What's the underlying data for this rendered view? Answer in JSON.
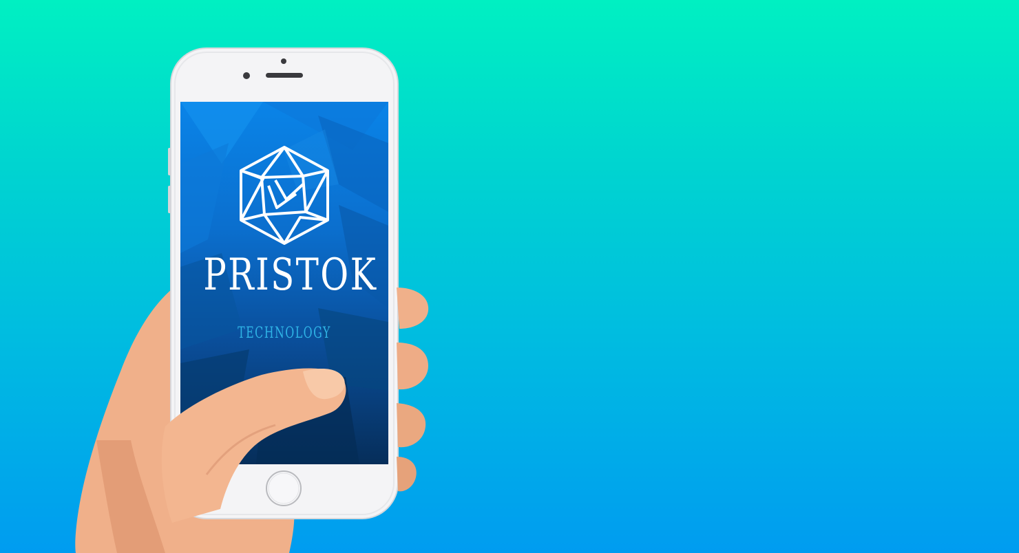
{
  "app": {
    "brand_name": "PRISTOK",
    "tagline": "TECHNOLOGY",
    "logo_icon": "geometric-polyhedron-logo"
  },
  "colors": {
    "background_top": "#00f0c2",
    "background_bottom": "#009cf0",
    "screen_top": "#0a84e8",
    "screen_bottom": "#062e5a",
    "tagline": "#2fb4e6",
    "phone_body": "#f4f4f6"
  }
}
